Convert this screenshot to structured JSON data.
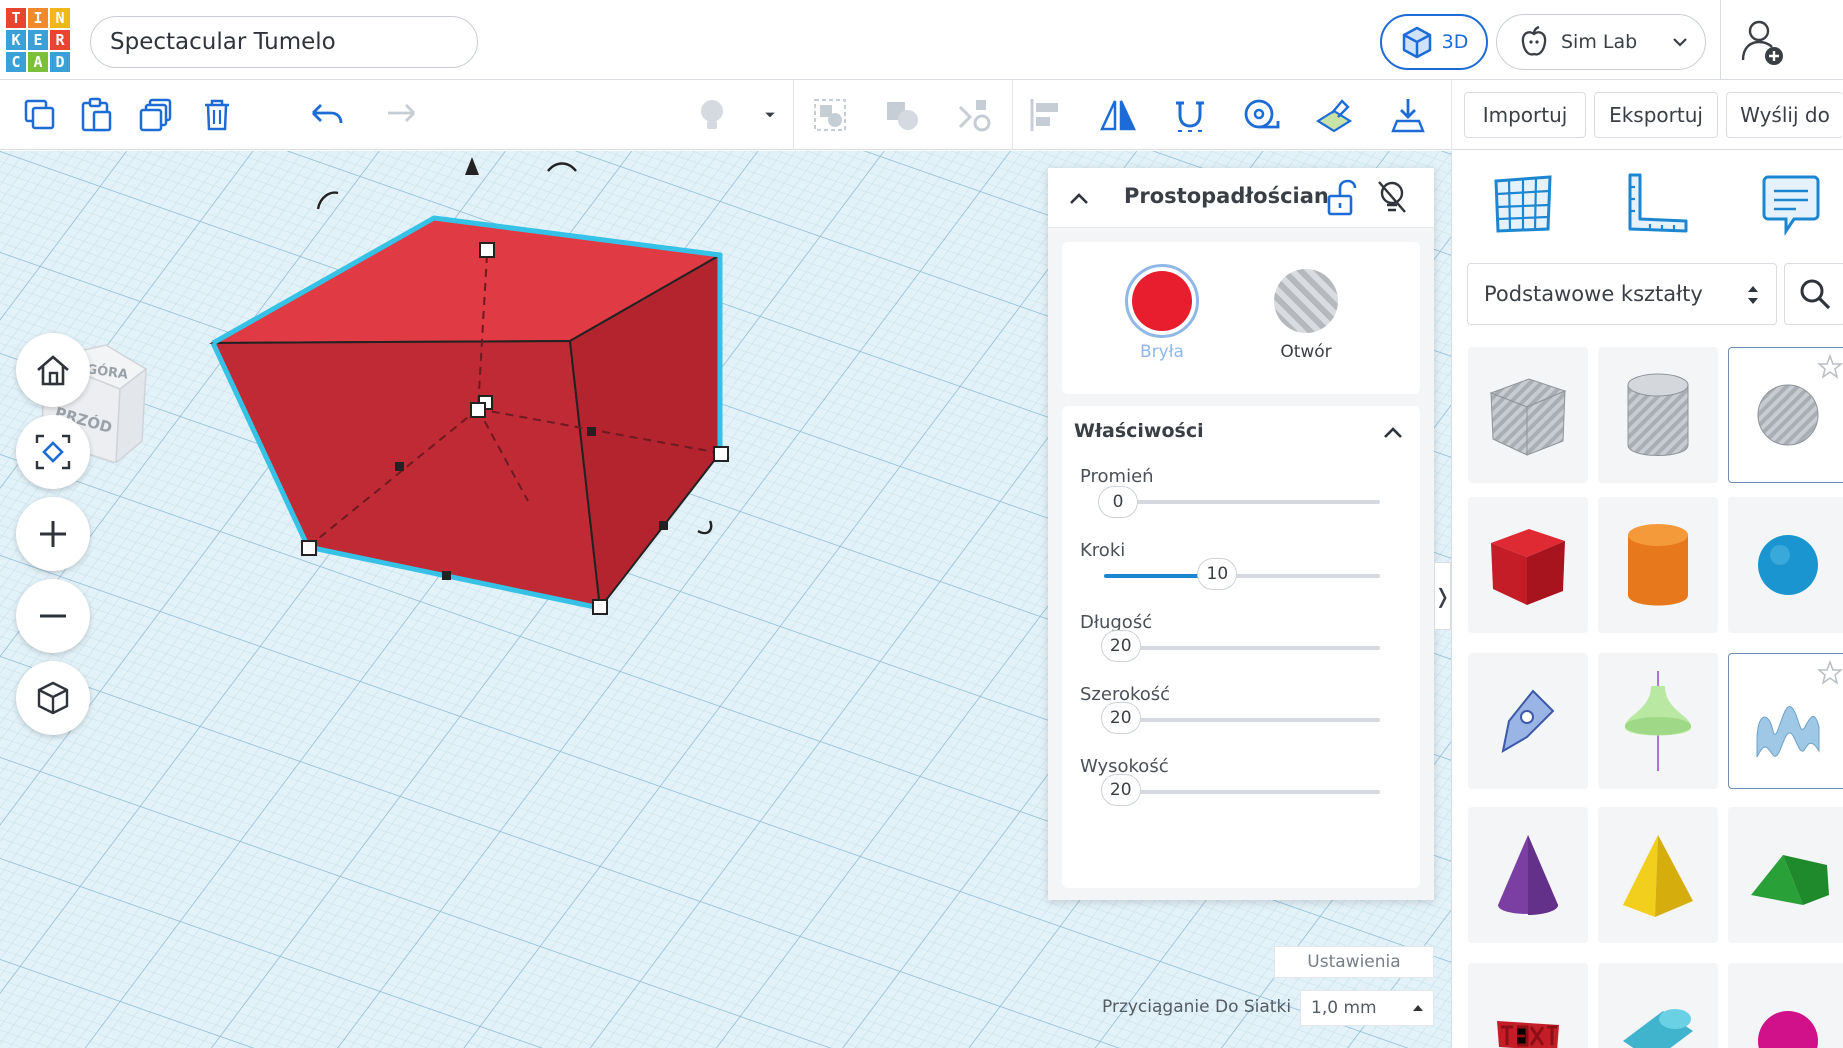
{
  "app": {
    "logo_letters": [
      "T",
      "I",
      "N",
      "K",
      "E",
      "R",
      "C",
      "A",
      "D"
    ],
    "logo_colors": [
      "#e8442e",
      "#f08a2b",
      "#f0b71c",
      "#39a0d8",
      "#39a0d8",
      "#e8442e",
      "#39a0d8",
      "#7bbf3a",
      "#39a0d8"
    ],
    "design_title": "Spectacular Tumelo"
  },
  "header": {
    "view_3d_label": "3D",
    "simlab_label": "Sim Lab",
    "accent_color": "#1c6bd6"
  },
  "toolbar": {
    "import_label": "Importuj",
    "export_label": "Eksportuj",
    "send_label": "Wyślij do"
  },
  "viewcube": {
    "top_label": "GÓRA",
    "front_label": "PRZÓD"
  },
  "inspector": {
    "title": "Prostopadłościan",
    "solid_label": "Bryła",
    "hole_label": "Otwór",
    "solid_color": "#e81e2e",
    "properties_title": "Właściwości",
    "properties": [
      {
        "label": "Promień",
        "value": "0",
        "fraction": 0.0
      },
      {
        "label": "Kroki",
        "value": "10",
        "fraction": 0.36
      },
      {
        "label": "Długość",
        "value": "20",
        "fraction": 0.01
      },
      {
        "label": "Szerokość",
        "value": "20",
        "fraction": 0.01
      },
      {
        "label": "Wysokość",
        "value": "20",
        "fraction": 0.01
      }
    ]
  },
  "workplane": {
    "settings_label": "Ustawienia",
    "snap_label": "Przyciąganie Do Siatki",
    "snap_value": "1,0 mm",
    "box_color": "#d8353f",
    "outline_color": "#35c2e6"
  },
  "shapes_panel": {
    "category": "Podstawowe kształty",
    "shapes": [
      "box-hole",
      "cylinder-hole",
      "sphere-hole",
      "box",
      "cylinder",
      "sphere",
      "scribble",
      "paraboloid",
      "wave-hole",
      "cone",
      "pyramid",
      "roof",
      "text",
      "tube",
      "torus"
    ]
  }
}
